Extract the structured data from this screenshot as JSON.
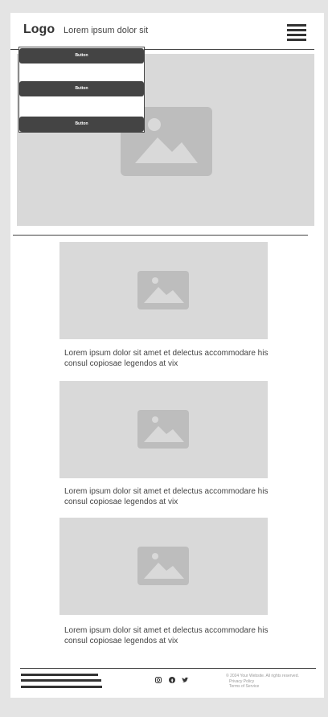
{
  "header": {
    "logo": "Logo",
    "tagline": "Lorem ipsum dolor sit"
  },
  "menu": {
    "buttons": [
      "Button",
      "Button",
      "Button"
    ]
  },
  "cards": [
    {
      "text": "Lorem ipsum dolor sit amet et delectus accommodare his consul copiosae legendos at vix"
    },
    {
      "text": "Lorem ipsum dolor sit amet et delectus accommodare his consul copiosae legendos at vix"
    },
    {
      "text": "Lorem ipsum dolor sit amet et delectus accommodare his consul copiosae legendos at vix"
    }
  ],
  "footer": {
    "copyright": "© 2024 Your Website. All rights reserved.",
    "privacy": "Privacy Policy",
    "terms": "Terms of Service",
    "social_icons": [
      "instagram-icon",
      "facebook-icon",
      "twitter-icon"
    ]
  },
  "colors": {
    "placeholder_bg": "#d9d9d9",
    "placeholder_icon": "#bdbdbd",
    "dark": "#444444"
  }
}
